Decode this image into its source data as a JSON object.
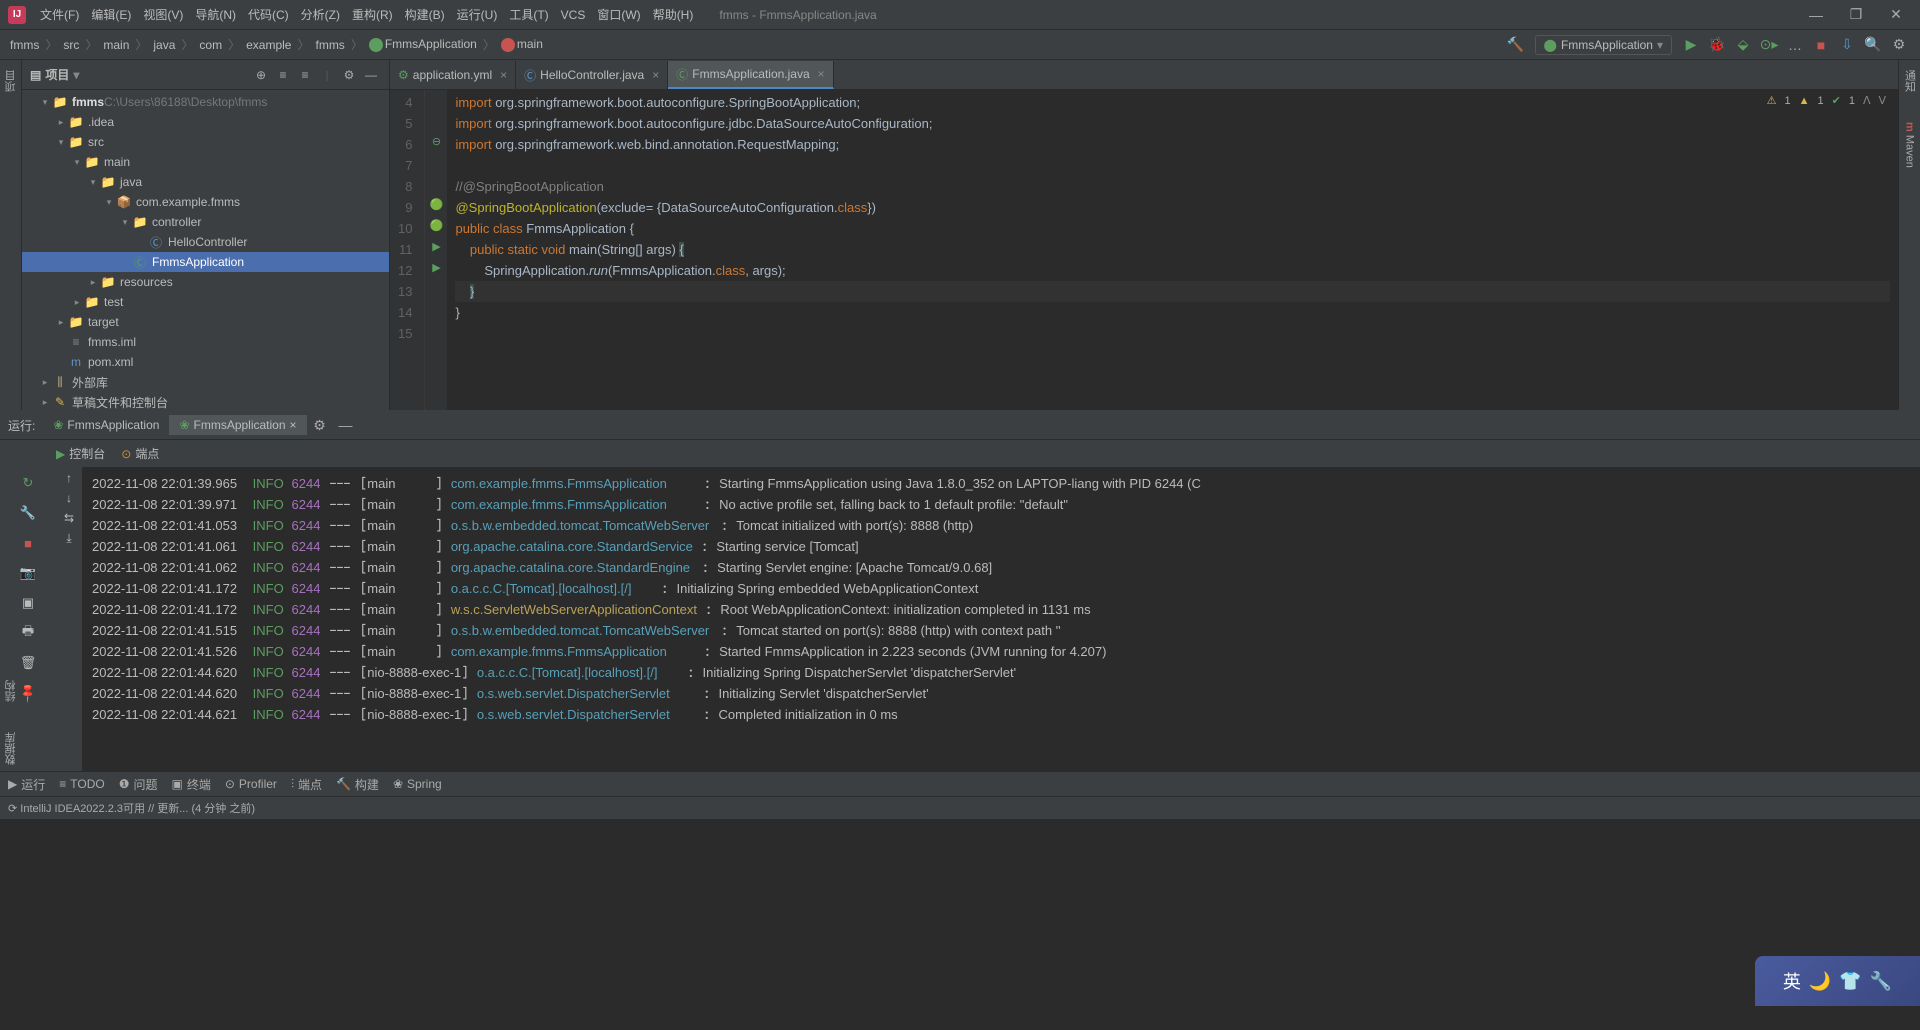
{
  "window": {
    "title": "fmms - FmmsApplication.java"
  },
  "menu": [
    "文件(F)",
    "编辑(E)",
    "视图(V)",
    "导航(N)",
    "代码(C)",
    "分析(Z)",
    "重构(R)",
    "构建(B)",
    "运行(U)",
    "工具(T)",
    "VCS",
    "窗口(W)",
    "帮助(H)"
  ],
  "breadcrumbs": [
    "fmms",
    "src",
    "main",
    "java",
    "com",
    "example",
    "fmms",
    "FmmsApplication",
    "main"
  ],
  "runConfig": "FmmsApplication",
  "project": {
    "title": "项目",
    "root": {
      "name": "fmms",
      "path": "C:\\Users\\86188\\Desktop\\fmms"
    },
    "nodes": [
      {
        "indent": 1,
        "arrow": "▾",
        "icon": "📁",
        "name": "fmms",
        "dim": "C:\\Users\\86188\\Desktop\\fmms",
        "cls": "folder-ico",
        "bold": true
      },
      {
        "indent": 2,
        "arrow": "▸",
        "icon": "📁",
        "name": ".idea",
        "cls": "folder-ico"
      },
      {
        "indent": 2,
        "arrow": "▾",
        "icon": "📁",
        "name": "src",
        "cls": "folder-blue"
      },
      {
        "indent": 3,
        "arrow": "▾",
        "icon": "📁",
        "name": "main",
        "cls": "folder-ico"
      },
      {
        "indent": 4,
        "arrow": "▾",
        "icon": "📁",
        "name": "java",
        "cls": "folder-blue"
      },
      {
        "indent": 5,
        "arrow": "▾",
        "icon": "📦",
        "name": "com.example.fmms",
        "cls": "folder-ico"
      },
      {
        "indent": 6,
        "arrow": "▾",
        "icon": "📁",
        "name": "controller",
        "cls": "folder-ico"
      },
      {
        "indent": 7,
        "arrow": "",
        "icon": "Ⓒ",
        "name": "HelloController",
        "cls": "blue"
      },
      {
        "indent": 6,
        "arrow": "",
        "icon": "Ⓒ",
        "name": "FmmsApplication",
        "cls": "green",
        "sel": true
      },
      {
        "indent": 4,
        "arrow": "▸",
        "icon": "📁",
        "name": "resources",
        "cls": "folder-ico"
      },
      {
        "indent": 3,
        "arrow": "▸",
        "icon": "📁",
        "name": "test",
        "cls": "folder-ico"
      },
      {
        "indent": 2,
        "arrow": "▸",
        "icon": "📁",
        "name": "target",
        "cls": "folder-orange"
      },
      {
        "indent": 2,
        "arrow": "",
        "icon": "≡",
        "name": "fmms.iml",
        "cls": "caret"
      },
      {
        "indent": 2,
        "arrow": "",
        "icon": "m",
        "name": "pom.xml",
        "cls": "blue"
      },
      {
        "indent": 1,
        "arrow": "▸",
        "icon": "⫼",
        "name": "外部库",
        "cls": "folder-ico"
      },
      {
        "indent": 1,
        "arrow": "▸",
        "icon": "✎",
        "name": "草稿文件和控制台",
        "cls": "yellow"
      }
    ]
  },
  "editorTabs": [
    {
      "icon": "⚙",
      "name": "application.yml",
      "sel": false,
      "iconColor": "#5b9e5f"
    },
    {
      "icon": "Ⓒ",
      "name": "HelloController.java",
      "sel": false,
      "iconColor": "#5896cc"
    },
    {
      "icon": "Ⓒ",
      "name": "FmmsApplication.java",
      "sel": true,
      "iconColor": "#5b9e5f"
    }
  ],
  "inspections": {
    "error": "1",
    "warn": "1",
    "ok": "1"
  },
  "codeLines": [
    {
      "n": 4,
      "gi": "",
      "html": "<span class='kw'>import</span> org.springframework.boot.autoconfigure.<span class='cls'>SpringBootApplication</span>;"
    },
    {
      "n": 5,
      "gi": "",
      "html": "<span class='kw'>import</span> org.springframework.boot.autoconfigure.jdbc.<span class='cls'>DataSourceAutoConfiguration</span>;"
    },
    {
      "n": 6,
      "gi": "⊖",
      "html": "<span class='kw'>import</span> org.springframework.web.bind.annotation.<span class='cls'>RequestMapping</span>;"
    },
    {
      "n": 7,
      "gi": "",
      "html": ""
    },
    {
      "n": 8,
      "gi": "",
      "html": "<span class='com'>//@SpringBootApplication</span>"
    },
    {
      "n": 9,
      "gi": "🟢",
      "html": "<span class='ann'>@SpringBootApplication</span>(exclude= {DataSourceAutoConfiguration.<span class='kw'>class</span>})"
    },
    {
      "n": 10,
      "gi": "🟢▶",
      "html": "<span class='kw'>public class</span> <span class='cls'>FmmsApplication</span> {"
    },
    {
      "n": 11,
      "gi": "▶",
      "html": "    <span class='kw'>public static void</span> <span class='cls'>main</span>(String[] args) <span style='background:#3b514d'>{</span>"
    },
    {
      "n": 12,
      "gi": "",
      "html": "        SpringApplication.<span class='it'>run</span>(FmmsApplication.<span class='kw'>class</span>, args);"
    },
    {
      "n": 13,
      "gi": "",
      "html": "    <span style='background:#3b514d'>}</span>",
      "hl": true
    },
    {
      "n": 14,
      "gi": "",
      "html": "}"
    },
    {
      "n": 15,
      "gi": "",
      "html": ""
    }
  ],
  "runPanel": {
    "label": "运行:",
    "tabs": [
      {
        "name": "FmmsApplication",
        "sel": false
      },
      {
        "name": "FmmsApplication",
        "sel": true
      }
    ],
    "subtabs": [
      {
        "icon": "▶",
        "name": "控制台"
      },
      {
        "icon": "⊙",
        "name": "端点"
      }
    ]
  },
  "consoleLines": [
    {
      "ts": "2022-11-08 22:01:39.965",
      "lvl": "INFO",
      "pid": "6244",
      "thr": "main",
      "logger": "com.example.fmms.FmmsApplication",
      "msg": "Starting FmmsApplication using Java 1.8.0_352 on LAPTOP-liang with PID 6244 (C"
    },
    {
      "ts": "2022-11-08 22:01:39.971",
      "lvl": "INFO",
      "pid": "6244",
      "thr": "main",
      "logger": "com.example.fmms.FmmsApplication",
      "msg": "No active profile set, falling back to 1 default profile: \"default\""
    },
    {
      "ts": "2022-11-08 22:01:41.053",
      "lvl": "INFO",
      "pid": "6244",
      "thr": "main",
      "logger": "o.s.b.w.embedded.tomcat.TomcatWebServer",
      "msg": "Tomcat initialized with port(s): 8888 (http)"
    },
    {
      "ts": "2022-11-08 22:01:41.061",
      "lvl": "INFO",
      "pid": "6244",
      "thr": "main",
      "logger": "org.apache.catalina.core.StandardService",
      "msg": "Starting service [Tomcat]"
    },
    {
      "ts": "2022-11-08 22:01:41.062",
      "lvl": "INFO",
      "pid": "6244",
      "thr": "main",
      "logger": "org.apache.catalina.core.StandardEngine",
      "msg": "Starting Servlet engine: [Apache Tomcat/9.0.68]"
    },
    {
      "ts": "2022-11-08 22:01:41.172",
      "lvl": "INFO",
      "pid": "6244",
      "thr": "main",
      "logger": "o.a.c.c.C.[Tomcat].[localhost].[/]",
      "msg": "Initializing Spring embedded WebApplicationContext"
    },
    {
      "ts": "2022-11-08 22:01:41.172",
      "lvl": "INFO",
      "pid": "6244",
      "thr": "main",
      "logger": "w.s.c.ServletWebServerApplicationContext",
      "loggerCls": "loggerY",
      "msg": "Root WebApplicationContext: initialization completed in 1131 ms"
    },
    {
      "ts": "2022-11-08 22:01:41.515",
      "lvl": "INFO",
      "pid": "6244",
      "thr": "main",
      "logger": "o.s.b.w.embedded.tomcat.TomcatWebServer",
      "msg": "Tomcat started on port(s): 8888 (http) with context path ''"
    },
    {
      "ts": "2022-11-08 22:01:41.526",
      "lvl": "INFO",
      "pid": "6244",
      "thr": "main",
      "logger": "com.example.fmms.FmmsApplication",
      "msg": "Started FmmsApplication in 2.223 seconds (JVM running for 4.207)"
    },
    {
      "ts": "2022-11-08 22:01:44.620",
      "lvl": "INFO",
      "pid": "6244",
      "thr": "nio-8888-exec-1",
      "logger": "o.a.c.c.C.[Tomcat].[localhost].[/]",
      "msg": "Initializing Spring DispatcherServlet 'dispatcherServlet'"
    },
    {
      "ts": "2022-11-08 22:01:44.620",
      "lvl": "INFO",
      "pid": "6244",
      "thr": "nio-8888-exec-1",
      "logger": "o.s.web.servlet.DispatcherServlet",
      "msg": "Initializing Servlet 'dispatcherServlet'"
    },
    {
      "ts": "2022-11-08 22:01:44.621",
      "lvl": "INFO",
      "pid": "6244",
      "thr": "nio-8888-exec-1",
      "logger": "o.s.web.servlet.DispatcherServlet",
      "msg": "Completed initialization in 0 ms"
    }
  ],
  "bottomItems": [
    {
      "icon": "▶",
      "name": "运行"
    },
    {
      "icon": "≡",
      "name": "TODO"
    },
    {
      "icon": "❶",
      "name": "问题"
    },
    {
      "icon": "▣",
      "name": "终端"
    },
    {
      "icon": "⊙",
      "name": "Profiler"
    },
    {
      "icon": "⫶",
      "name": "端点"
    },
    {
      "icon": "🔨",
      "name": "构建"
    },
    {
      "icon": "❀",
      "name": "Spring"
    }
  ],
  "status": "IntelliJ IDEA2022.2.3可用 // 更新... (4 分钟 之前)",
  "leftStrip": [
    "项目",
    "结构",
    "数据库"
  ],
  "rightStrip": [
    "通知",
    "Maven"
  ],
  "floaty": "英"
}
